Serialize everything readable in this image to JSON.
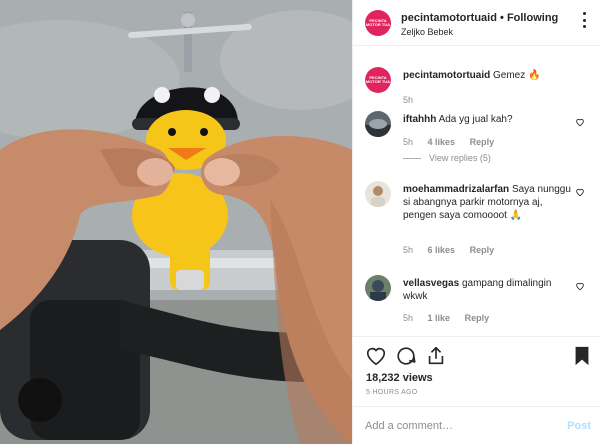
{
  "post": {
    "username": "pecintamotortuaid",
    "separator": "•",
    "follow_label": "Following",
    "location": "Zeljko Bebek",
    "avatar_text": "PECINTA MOTOR TUA"
  },
  "caption": {
    "username": "pecintamotortuaid",
    "text": "Gemez 🔥",
    "time": "5h"
  },
  "comments": [
    {
      "username": "iftahhh",
      "text": "Ada yg jual kah?",
      "time": "5h",
      "likes": "4 likes",
      "reply": "Reply",
      "view_replies": "View replies (5)"
    },
    {
      "username": "moehammadrizalarfan",
      "text": "Saya nunggu si abangnya parkir motornya aj, pengen saya comoooot 🙏",
      "time": "5h",
      "likes": "6 likes",
      "reply": "Reply"
    },
    {
      "username": "vellasvegas",
      "text": "gampang dimalingin wkwk",
      "time": "5h",
      "likes": "1 like",
      "reply": "Reply"
    }
  ],
  "actions": {
    "views": "18,232 views",
    "time_ago": "5 HOURS AGO"
  },
  "add_comment": {
    "placeholder": "Add a comment…",
    "post_label": "Post"
  },
  "colors": {
    "brand_avatar": "#e0245e",
    "post_button_disabled": "#b2dffc",
    "muted_text": "#8e8e8e"
  },
  "icons": [
    "more-options-icon",
    "heart-icon",
    "comment-icon",
    "share-icon",
    "bookmark-icon",
    "comment-like-icon"
  ]
}
